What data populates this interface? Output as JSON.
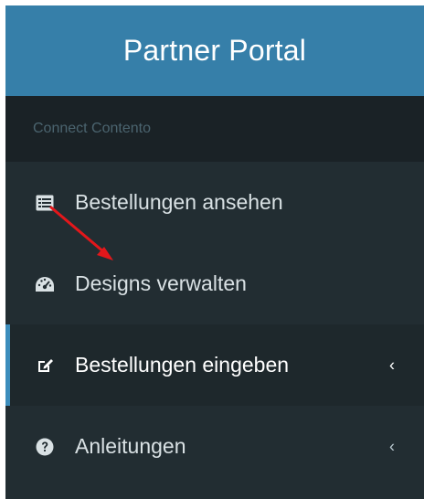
{
  "brand": {
    "title": "Partner Portal"
  },
  "section": {
    "header": "Connect Contento"
  },
  "menu": {
    "items": [
      {
        "label": "Bestellungen ansehen",
        "icon": "list-alt-icon",
        "active": false,
        "has_chevron": false
      },
      {
        "label": "Designs verwalten",
        "icon": "dashboard-gauge-icon",
        "active": false,
        "has_chevron": false
      },
      {
        "label": "Bestellungen eingeben",
        "icon": "edit-icon",
        "active": true,
        "has_chevron": true,
        "chevron": "‹"
      },
      {
        "label": "Anleitungen",
        "icon": "question-circle-icon",
        "active": false,
        "has_chevron": true,
        "chevron": "‹"
      }
    ]
  },
  "colors": {
    "brand_bg": "#367fa9",
    "sidebar_bg": "#222d32",
    "section_bg": "#1a2226",
    "active_border": "#3c8dbc",
    "annotation_arrow": "#e3171b"
  }
}
